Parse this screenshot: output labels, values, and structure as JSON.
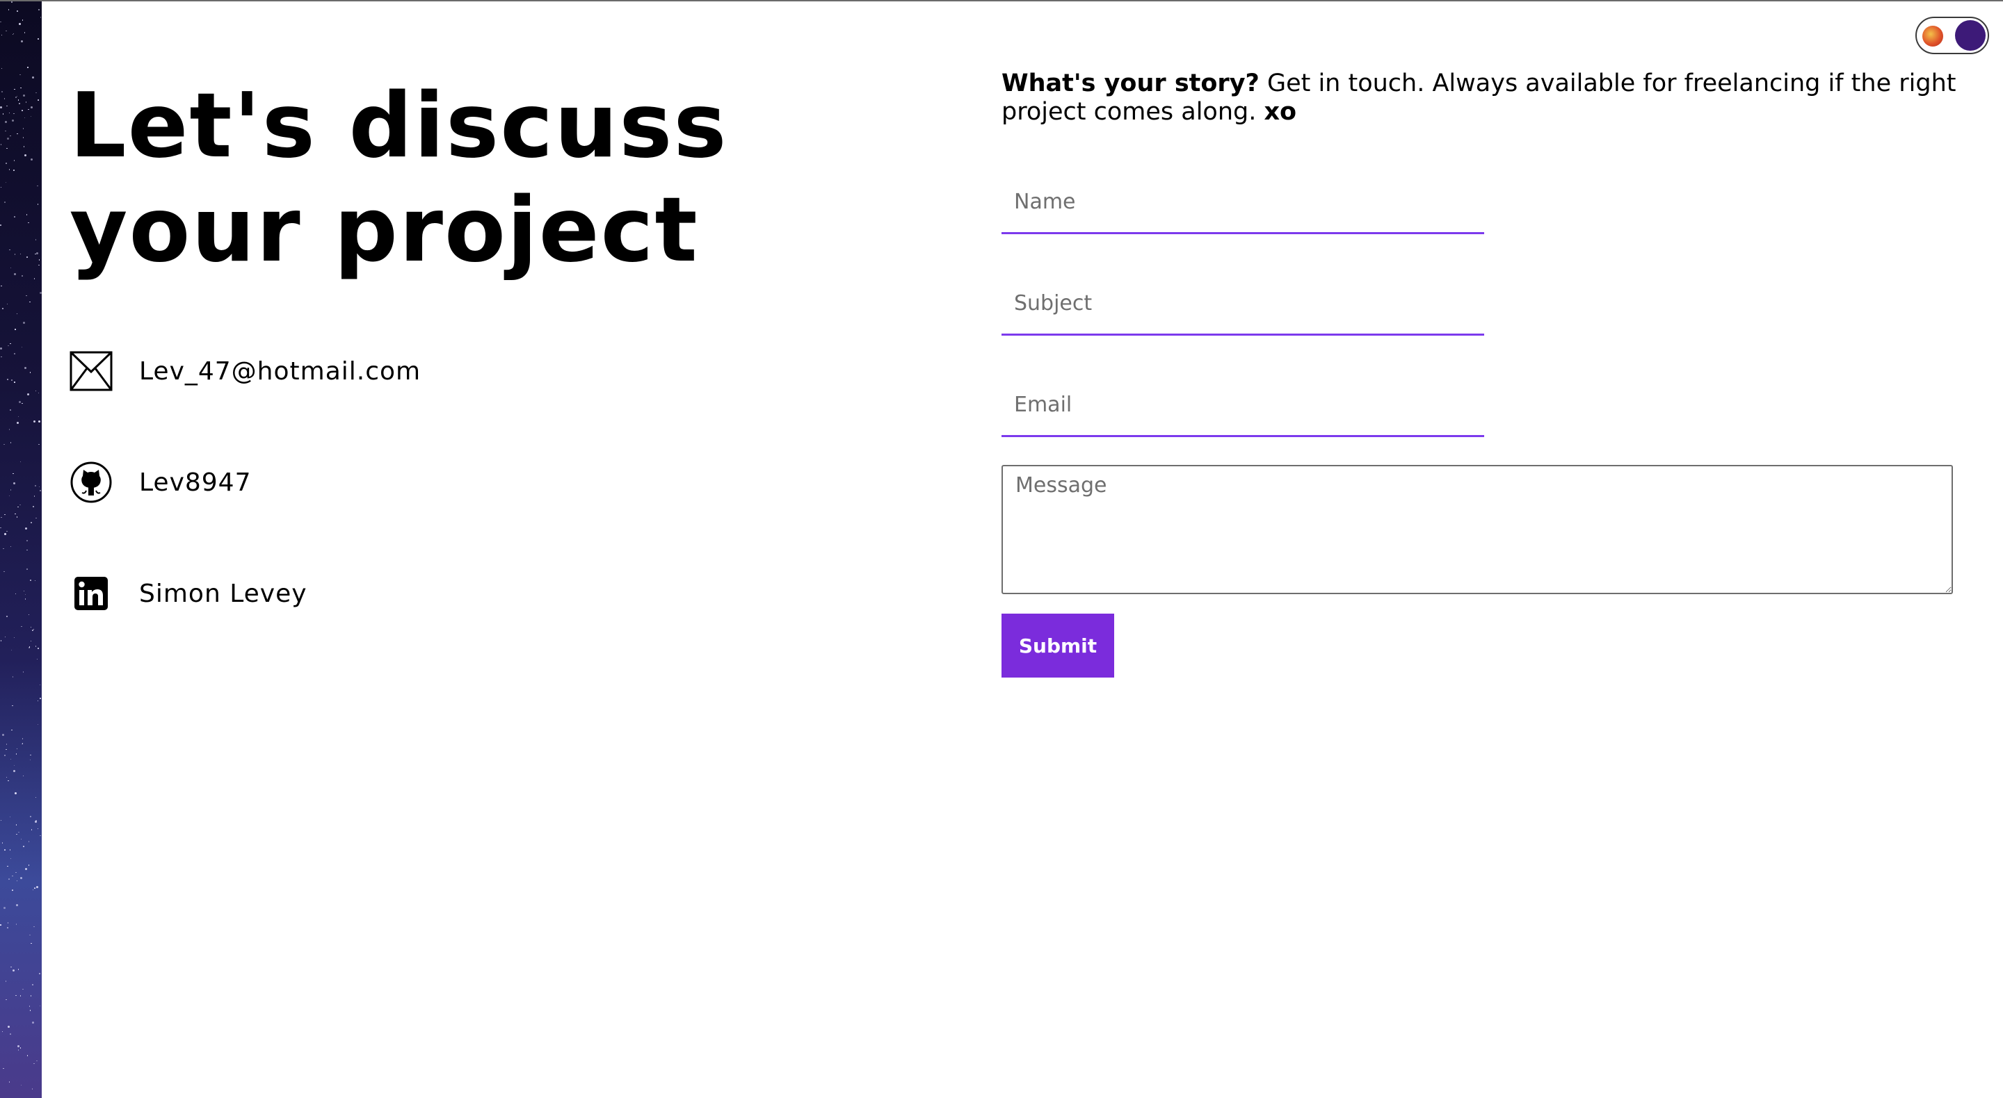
{
  "colors": {
    "accent": "#7b2cdc",
    "underline": "#7c3aed",
    "toggle_knob": "#3d1a78",
    "text": "#000000"
  },
  "theme_toggle": {
    "icons": [
      "sun-icon",
      "moon-knob"
    ]
  },
  "hero": {
    "heading_line1": "Let's discuss",
    "heading_line2": "your project"
  },
  "contacts": [
    {
      "icon": "envelope-icon",
      "label": "Lev_47@hotmail.com"
    },
    {
      "icon": "github-icon",
      "label": "Lev8947"
    },
    {
      "icon": "linkedin-icon",
      "label": "Simon Levey"
    }
  ],
  "intro": {
    "lead": "What's your story?",
    "body": " Get in touch. Always available for freelancing if the right project comes along. ",
    "signoff": "xo"
  },
  "form": {
    "name_placeholder": "Name",
    "subject_placeholder": "Subject",
    "email_placeholder": "Email",
    "message_placeholder": "Message",
    "submit_label": "Submit"
  }
}
